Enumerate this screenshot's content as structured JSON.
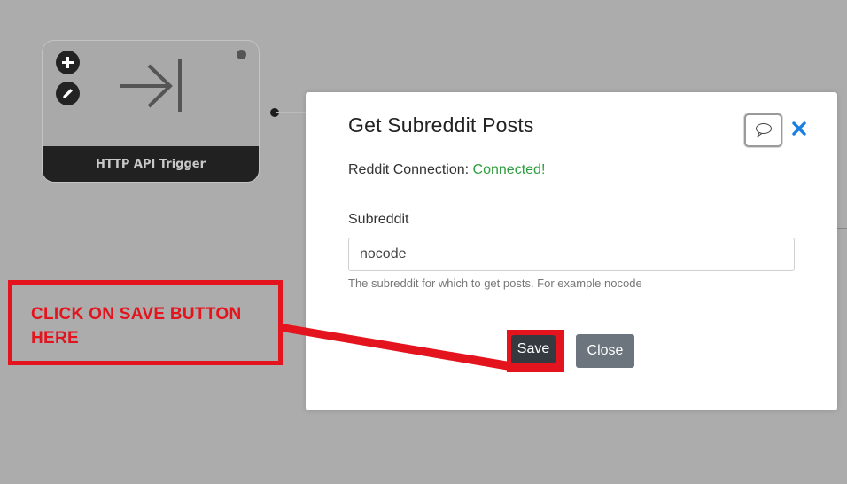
{
  "node": {
    "title": "HTTP API Trigger",
    "icons": [
      "plus-icon",
      "pencil-icon",
      "arrow-to-bar-icon"
    ]
  },
  "modal": {
    "title": "Get Subreddit Posts",
    "connection_label": "Reddit Connection:",
    "connection_status": "Connected!",
    "field_label": "Subreddit",
    "field_value": "nocode",
    "help_text": "The subreddit for which to get posts. For example nocode",
    "save_label": "Save",
    "close_label": "Close",
    "comment_icon": "speech-bubble-icon",
    "close_icon": "close-icon"
  },
  "annotation": {
    "text": "CLICK ON SAVE BUTTON HERE"
  },
  "colors": {
    "background": "#acacac",
    "annotation_red": "#e3141d",
    "connected_green": "#2e9e3e",
    "close_x_blue": "#1a7fe0",
    "save_dark": "#343a40",
    "close_gray": "#6c757d"
  }
}
